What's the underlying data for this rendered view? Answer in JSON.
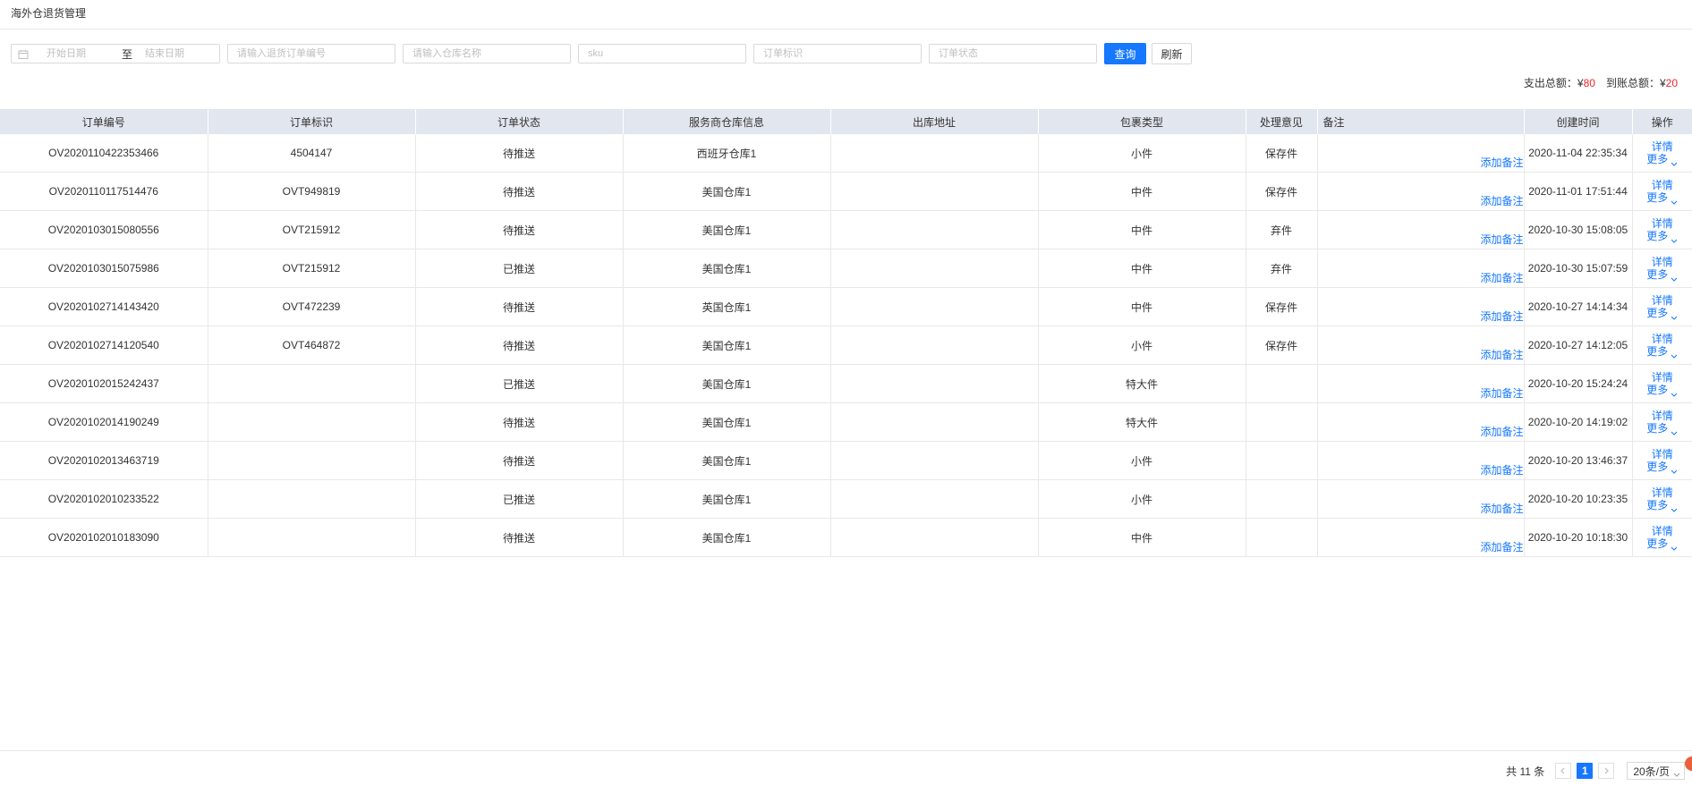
{
  "page": {
    "title": "海外仓退货管理"
  },
  "filters": {
    "start_date_placeholder": "开始日期",
    "date_separator": "至",
    "end_date_placeholder": "结束日期",
    "return_order_placeholder": "请输入退货订单编号",
    "warehouse_placeholder": "请输入仓库名称",
    "sku_placeholder": "sku",
    "order_mark_placeholder": "订单标识",
    "order_status_placeholder": "订单状态",
    "query_label": "查询",
    "refresh_label": "刷新"
  },
  "totals": {
    "expense_label": "支出总额：¥",
    "expense_value": "80",
    "received_label": "到账总额：¥",
    "received_value": "20"
  },
  "table": {
    "columns": [
      "订单编号",
      "订单标识",
      "订单状态",
      "服务商仓库信息",
      "出库地址",
      "包裹类型",
      "处理意见",
      "备注",
      "创建时间",
      "操作"
    ],
    "add_remark_label": "添加备注",
    "detail_label": "详情",
    "more_label": "更多",
    "rows": [
      {
        "order_no": "OV2020110422353466",
        "mark": "4504147",
        "status": "待推送",
        "warehouse": "西班牙仓库1",
        "address": "",
        "package": "小件",
        "opinion": "保存件",
        "created": "2020-11-04 22:35:34"
      },
      {
        "order_no": "OV2020110117514476",
        "mark": "OVT949819",
        "status": "待推送",
        "warehouse": "美国仓库1",
        "address": "",
        "package": "中件",
        "opinion": "保存件",
        "created": "2020-11-01 17:51:44"
      },
      {
        "order_no": "OV2020103015080556",
        "mark": "OVT215912",
        "status": "待推送",
        "warehouse": "美国仓库1",
        "address": "",
        "package": "中件",
        "opinion": "弃件",
        "created": "2020-10-30 15:08:05"
      },
      {
        "order_no": "OV2020103015075986",
        "mark": "OVT215912",
        "status": "已推送",
        "warehouse": "美国仓库1",
        "address": "",
        "package": "中件",
        "opinion": "弃件",
        "created": "2020-10-30 15:07:59"
      },
      {
        "order_no": "OV2020102714143420",
        "mark": "OVT472239",
        "status": "待推送",
        "warehouse": "英国仓库1",
        "address": "",
        "package": "中件",
        "opinion": "保存件",
        "created": "2020-10-27 14:14:34"
      },
      {
        "order_no": "OV2020102714120540",
        "mark": "OVT464872",
        "status": "待推送",
        "warehouse": "美国仓库1",
        "address": "",
        "package": "小件",
        "opinion": "保存件",
        "created": "2020-10-27 14:12:05"
      },
      {
        "order_no": "OV2020102015242437",
        "mark": "",
        "status": "已推送",
        "warehouse": "美国仓库1",
        "address": "",
        "package": "特大件",
        "opinion": "",
        "created": "2020-10-20 15:24:24"
      },
      {
        "order_no": "OV2020102014190249",
        "mark": "",
        "status": "待推送",
        "warehouse": "美国仓库1",
        "address": "",
        "package": "特大件",
        "opinion": "",
        "created": "2020-10-20 14:19:02"
      },
      {
        "order_no": "OV2020102013463719",
        "mark": "",
        "status": "待推送",
        "warehouse": "美国仓库1",
        "address": "",
        "package": "小件",
        "opinion": "",
        "created": "2020-10-20 13:46:37"
      },
      {
        "order_no": "OV2020102010233522",
        "mark": "",
        "status": "已推送",
        "warehouse": "美国仓库1",
        "address": "",
        "package": "小件",
        "opinion": "",
        "created": "2020-10-20 10:23:35"
      },
      {
        "order_no": "OV2020102010183090",
        "mark": "",
        "status": "待推送",
        "warehouse": "美国仓库1",
        "address": "",
        "package": "中件",
        "opinion": "",
        "created": "2020-10-20 10:18:30"
      }
    ]
  },
  "pagination": {
    "total_text": "共 11 条",
    "current_page": "1",
    "page_size": "20条/页"
  },
  "icons": {
    "calendar": "calendar-icon",
    "chevron_down": "chevron-down-icon",
    "prev": "chevron-left-icon",
    "next": "chevron-right-icon"
  },
  "colors": {
    "primary": "#1677ff",
    "amount": "#f5222d",
    "header_bg": "#e2e6ee"
  }
}
